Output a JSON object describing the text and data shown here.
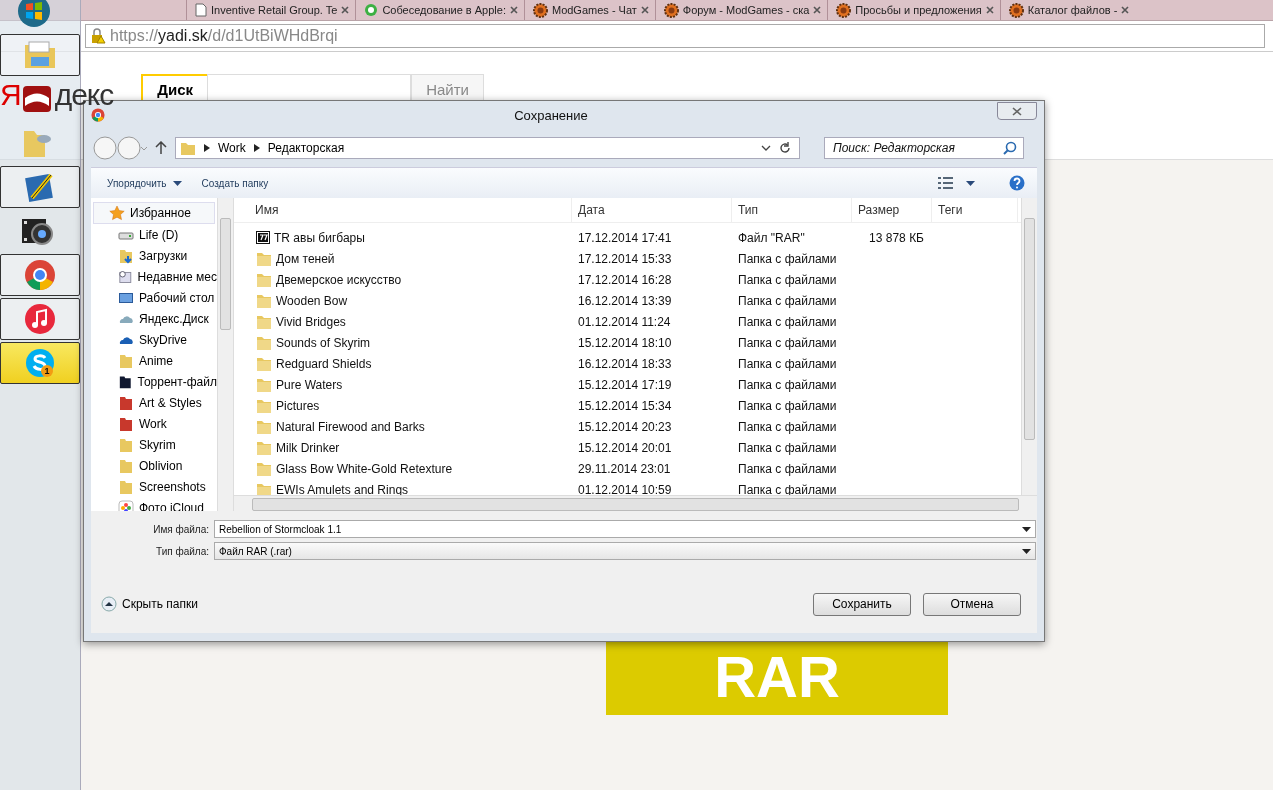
{
  "browser": {
    "tabs": [
      {
        "title": "Inventive Retail Group. Te",
        "kind": "doc"
      },
      {
        "title": "Собеседование в Apple:",
        "kind": "green"
      },
      {
        "title": "ModGames - Чат",
        "kind": "mg"
      },
      {
        "title": "Форум - ModGames - ска",
        "kind": "mg"
      },
      {
        "title": "Просьбы и предложения",
        "kind": "mg"
      },
      {
        "title": "Каталог файлов -",
        "kind": "mg"
      }
    ],
    "address": {
      "scheme": "https://",
      "host": "yadi.sk",
      "path": "/d/d1UtBiWHdBrqi"
    }
  },
  "taskbar": {
    "items": [
      {
        "kind": "explorer",
        "running": true,
        "selected": false
      },
      {
        "kind": "book",
        "running": false,
        "selected": false
      },
      {
        "kind": "folder",
        "running": false,
        "selected": false
      },
      {
        "kind": "pen",
        "running": true,
        "selected": false
      },
      {
        "kind": "video",
        "running": false,
        "selected": false
      },
      {
        "kind": "chrome",
        "running": true,
        "selected": false
      },
      {
        "kind": "music",
        "running": true,
        "selected": false
      },
      {
        "kind": "skype",
        "running": true,
        "selected": true,
        "badge": "1"
      }
    ]
  },
  "page": {
    "logo": [
      "Я",
      "декс"
    ],
    "search": {
      "service": "Диск",
      "button": "Найти"
    },
    "banner": "RAR"
  },
  "dialog": {
    "title": "Сохранение",
    "breadcrumb": [
      "Work",
      "Редакторская"
    ],
    "search_placeholder": "Поиск: Редакторская",
    "toolbar": {
      "organize": "Упорядочить",
      "new_folder": "Создать папку"
    },
    "sidebar": {
      "header": "Избранное",
      "items": [
        {
          "label": "Life (D)",
          "kind": "drive"
        },
        {
          "label": "Загрузки",
          "kind": "downloads"
        },
        {
          "label": "Недавние мес",
          "kind": "recent"
        },
        {
          "label": "Рабочий стол",
          "kind": "desktop"
        },
        {
          "label": "Яндекс.Диск",
          "kind": "cloud"
        },
        {
          "label": "SkyDrive",
          "kind": "skydrive"
        },
        {
          "label": "Anime",
          "kind": "folder"
        },
        {
          "label": "Торрент-файл",
          "kind": "dark"
        },
        {
          "label": "Art & Styles",
          "kind": "red"
        },
        {
          "label": "Work",
          "kind": "red"
        },
        {
          "label": "Skyrim",
          "kind": "folder"
        },
        {
          "label": "Oblivion",
          "kind": "folder"
        },
        {
          "label": "Screenshots",
          "kind": "folder"
        },
        {
          "label": "Фото iCloud",
          "kind": "photos"
        }
      ]
    },
    "columns": [
      "Имя",
      "Дата",
      "Тип",
      "Размер",
      "Теги"
    ],
    "rows": [
      {
        "kind": "archive",
        "name": "TR авы бигбары",
        "date": "17.12.2014 17:41",
        "type": "Файл \"RAR\"",
        "size": "13 878 КБ"
      },
      {
        "kind": "folder",
        "name": "Дом теней",
        "date": "17.12.2014 15:33",
        "type": "Папка с файлами"
      },
      {
        "kind": "folder",
        "name": "Двемерское искусство",
        "date": "17.12.2014 16:28",
        "type": "Папка с файлами"
      },
      {
        "kind": "folder",
        "name": "Wooden Bow",
        "date": "16.12.2014 13:39",
        "type": "Папка с файлами"
      },
      {
        "kind": "folder",
        "name": "Vivid Bridges",
        "date": "01.12.2014 11:24",
        "type": "Папка с файлами"
      },
      {
        "kind": "folder",
        "name": "Sounds of Skyrim",
        "date": "15.12.2014 18:10",
        "type": "Папка с файлами"
      },
      {
        "kind": "folder",
        "name": "Redguard Shields",
        "date": "16.12.2014 18:33",
        "type": "Папка с файлами"
      },
      {
        "kind": "folder",
        "name": "Pure Waters",
        "date": "15.12.2014 17:19",
        "type": "Папка с файлами"
      },
      {
        "kind": "folder",
        "name": "Pictures",
        "date": "15.12.2014 15:34",
        "type": "Папка с файлами"
      },
      {
        "kind": "folder",
        "name": "Natural Firewood and Barks",
        "date": "15.12.2014 20:23",
        "type": "Папка с файлами"
      },
      {
        "kind": "folder",
        "name": "Milk Drinker",
        "date": "15.12.2014 20:01",
        "type": "Папка с файлами"
      },
      {
        "kind": "folder",
        "name": "Glass Bow White-Gold Retexture",
        "date": "29.11.2014 23:01",
        "type": "Папка с файлами"
      },
      {
        "kind": "folder",
        "name": "EWIs Amulets and Rings",
        "date": "01.12.2014 10:59",
        "type": "Папка с файлами"
      }
    ],
    "file_name": {
      "label": "Имя файла:",
      "value": "Rebellion of Stormcloak 1.1"
    },
    "file_type": {
      "label": "Тип файла:",
      "value": "Файл RAR (.rar)"
    },
    "hide_folders": "Скрыть папки",
    "buttons": [
      "Сохранить",
      "Отмена"
    ]
  }
}
